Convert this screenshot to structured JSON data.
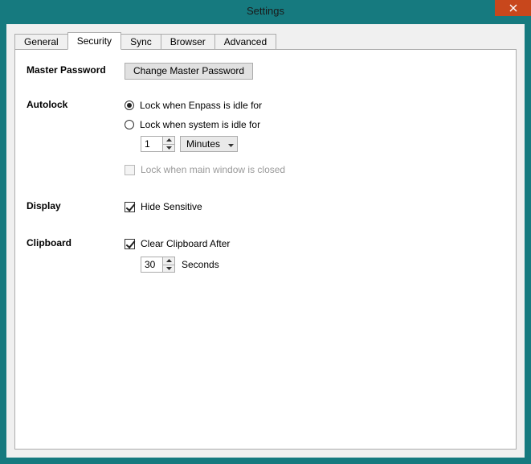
{
  "window": {
    "title": "Settings"
  },
  "tabs": {
    "t0": "General",
    "t1": "Security",
    "t2": "Sync",
    "t3": "Browser",
    "t4": "Advanced",
    "active": "Security"
  },
  "sections": {
    "master_password": {
      "label": "Master Password",
      "button": "Change Master Password"
    },
    "autolock": {
      "label": "Autolock",
      "radio_app_idle": "Lock when Enpass is idle for",
      "radio_system_idle": "Lock when system is idle for",
      "duration_value": "1",
      "duration_unit": "Minutes",
      "lock_on_close": "Lock when main window is closed"
    },
    "display": {
      "label": "Display",
      "hide_sensitive": "Hide Sensitive"
    },
    "clipboard": {
      "label": "Clipboard",
      "clear_after": "Clear Clipboard After",
      "seconds_value": "30",
      "seconds_unit": "Seconds"
    }
  }
}
